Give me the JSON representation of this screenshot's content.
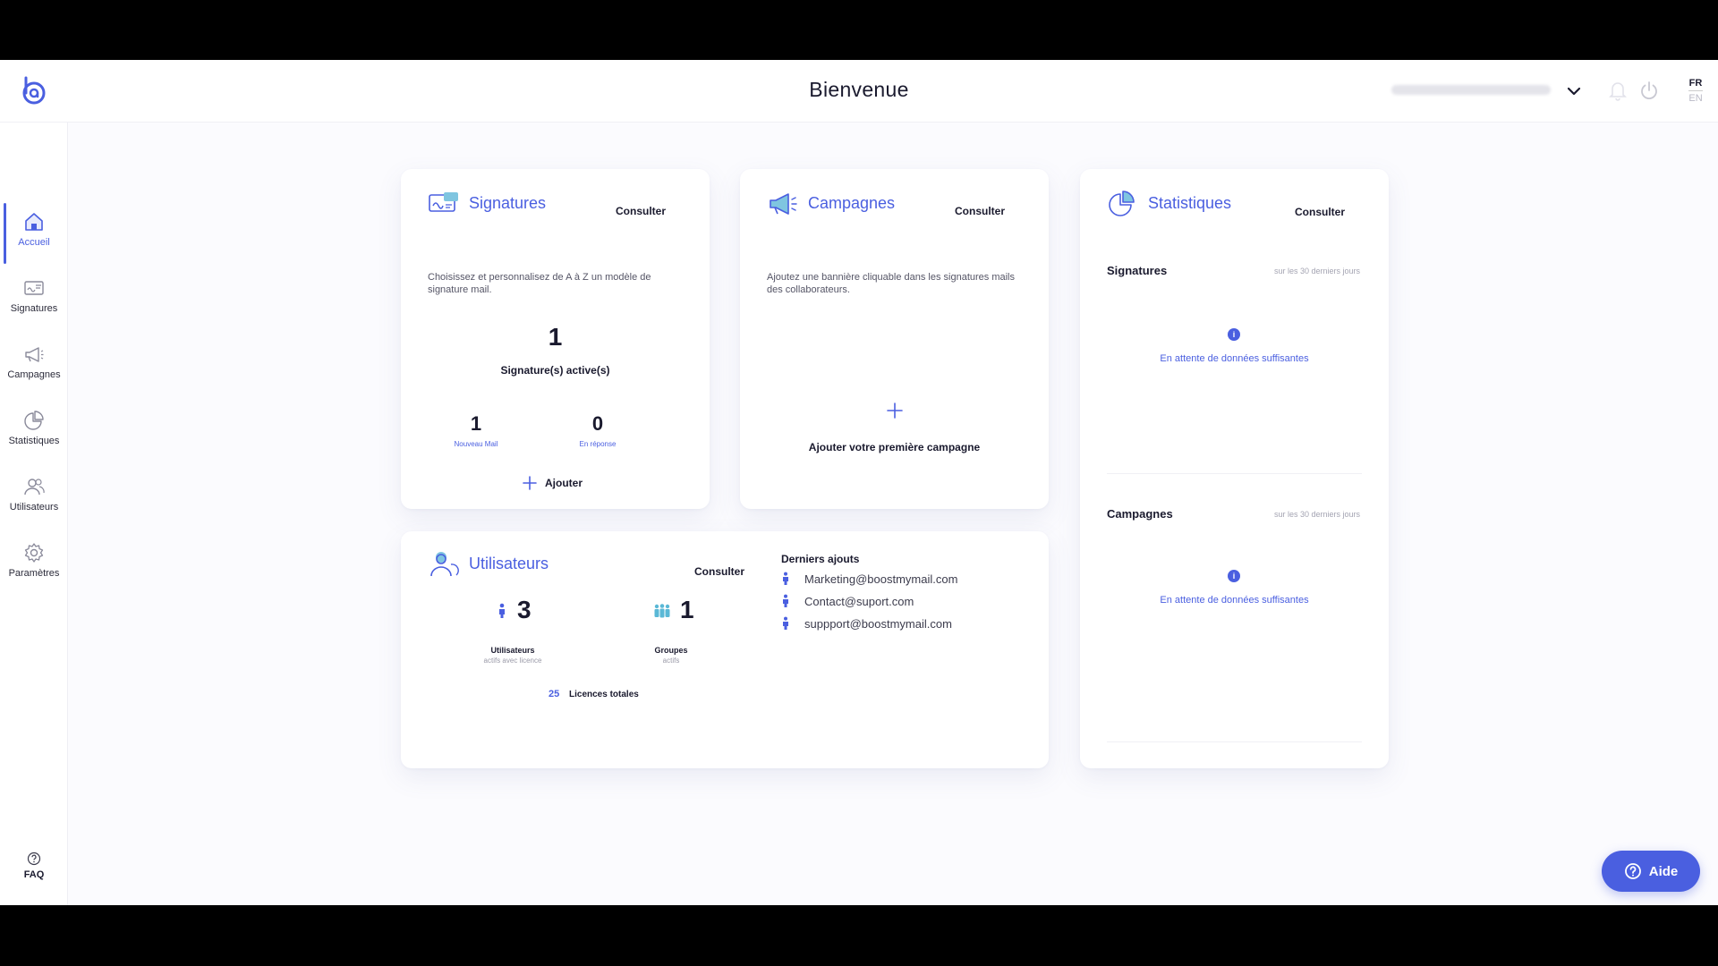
{
  "header": {
    "title": "Bienvenue",
    "user_email": "",
    "lang_active": "FR",
    "lang_other": "EN"
  },
  "sidebar": {
    "items": [
      {
        "label": "Accueil",
        "icon": "home-icon",
        "active": true
      },
      {
        "label": "Signatures",
        "icon": "signature-icon"
      },
      {
        "label": "Campagnes",
        "icon": "megaphone-icon"
      },
      {
        "label": "Statistiques",
        "icon": "pie-chart-icon"
      },
      {
        "label": "Utilisateurs",
        "icon": "users-icon"
      },
      {
        "label": "Paramètres",
        "icon": "gear-icon"
      }
    ],
    "faq": "FAQ"
  },
  "signatures_card": {
    "title": "Signatures",
    "consult": "Consulter",
    "description": "Choisissez et personnalisez de A à Z un modèle de signature mail.",
    "active_count": "1",
    "active_label": "Signature(s) active(s)",
    "new_mail_count": "1",
    "new_mail_label": "Nouveau Mail",
    "reply_count": "0",
    "reply_label": "En réponse",
    "add_label": "Ajouter"
  },
  "campaigns_card": {
    "title": "Campagnes",
    "consult": "Consulter",
    "description": "Ajoutez une bannière cliquable dans les signatures mails des collaborateurs.",
    "add_first": "Ajouter votre première campagne"
  },
  "stats_card": {
    "title": "Statistiques",
    "consult": "Consulter",
    "sections": [
      {
        "title": "Signatures",
        "range": "sur les 30 derniers jours",
        "status": "En attente de données suffisantes"
      },
      {
        "title": "Campagnes",
        "range": "sur les 30 derniers jours",
        "status": "En attente de données suffisantes"
      }
    ]
  },
  "users_card": {
    "title": "Utilisateurs",
    "consult": "Consulter",
    "users_count": "3",
    "users_label": "Utilisateurs",
    "users_sub": "actifs avec licence",
    "groups_count": "1",
    "groups_label": "Groupes",
    "groups_sub": "actifs",
    "licences_count": "25",
    "licences_label": "Licences totales",
    "recent_title": "Derniers ajouts",
    "recent": [
      "Marketing@boostmymail.com",
      "Contact@suport.com",
      "suppport@boostmymail.com"
    ]
  },
  "help_button": "Aide",
  "colors": {
    "accent": "#4a5fe0",
    "text": "#1a1a2e",
    "muted": "#a4a4b2"
  }
}
